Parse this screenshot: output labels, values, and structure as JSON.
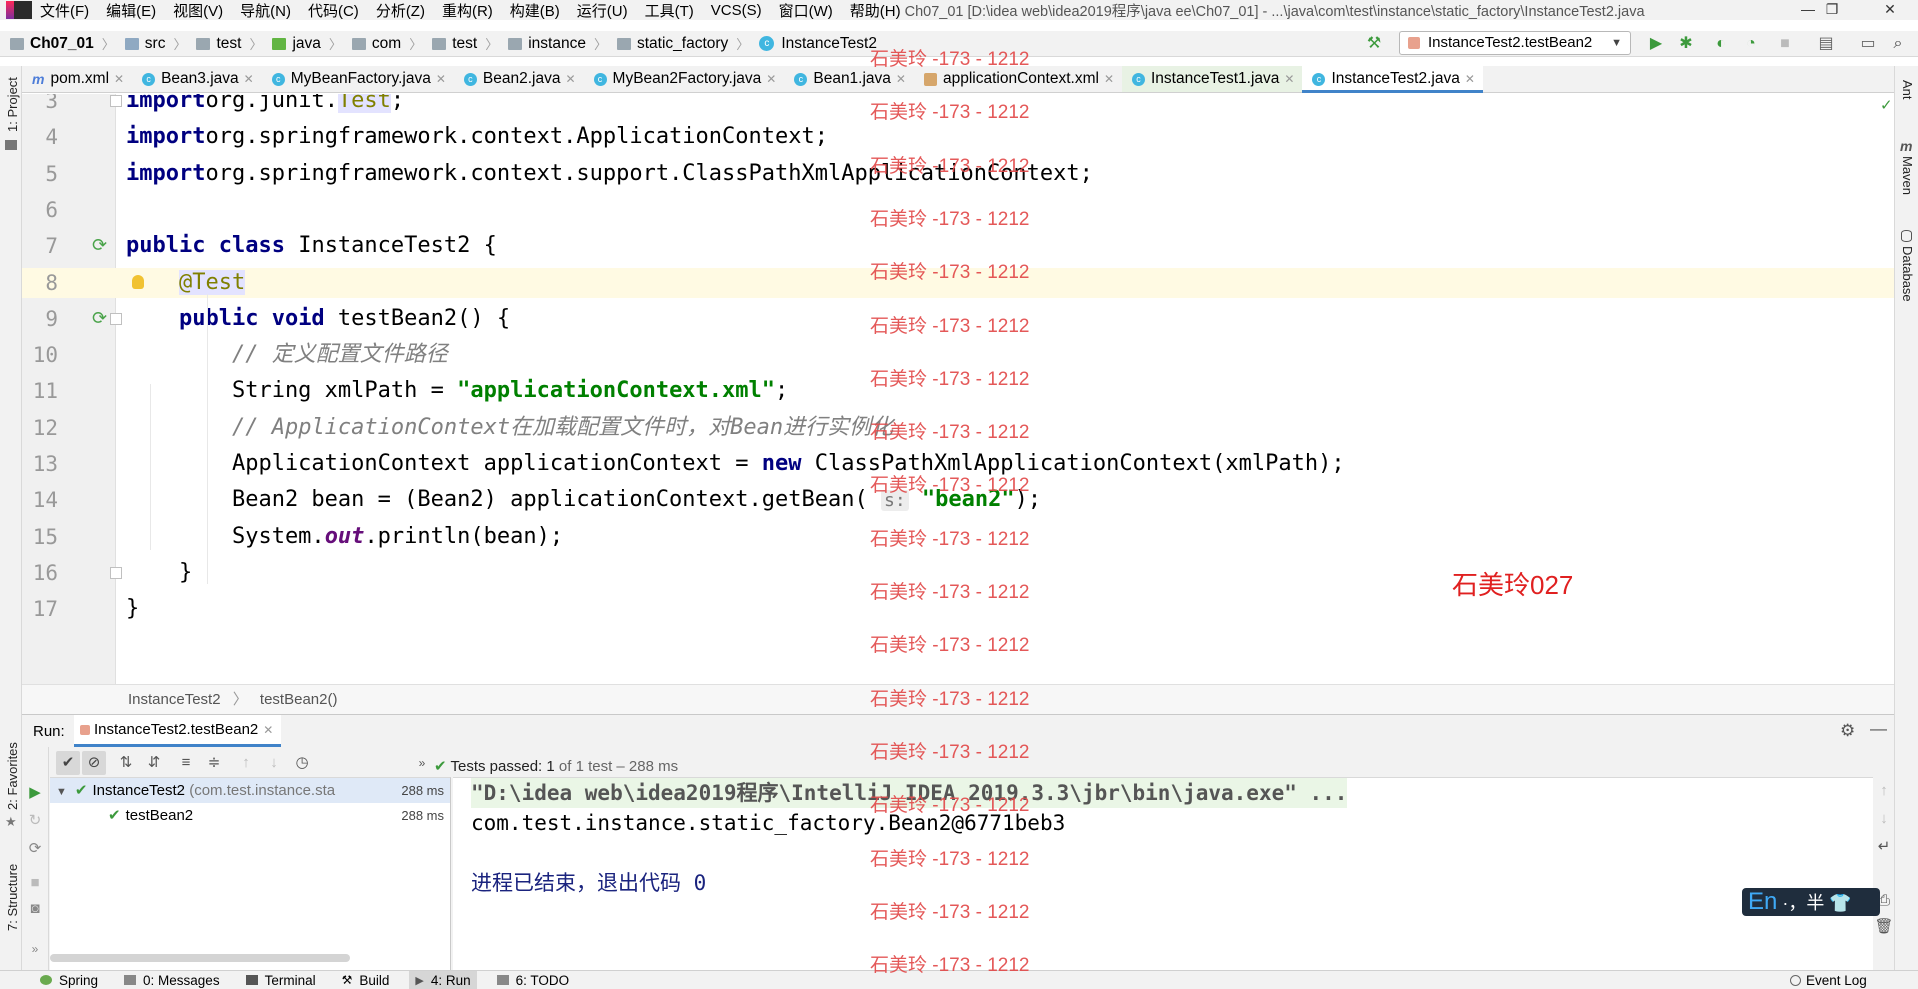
{
  "menubar": {
    "items": [
      "文件(F)",
      "编辑(E)",
      "视图(V)",
      "导航(N)",
      "代码(C)",
      "分析(Z)",
      "重构(R)",
      "构建(B)",
      "运行(U)",
      "工具(T)",
      "VCS(S)",
      "窗口(W)",
      "帮助(H)"
    ],
    "title": "Ch07_01 [D:\\idea web\\idea2019程序\\java ee\\Ch07_01] - ...\\java\\com\\test\\instance\\static_factory\\InstanceTest2.java"
  },
  "breadcrumb": [
    "Ch07_01",
    "src",
    "test",
    "java",
    "com",
    "test",
    "instance",
    "static_factory",
    "InstanceTest2"
  ],
  "run_config": "InstanceTest2.testBean2",
  "tabs": [
    "pom.xml",
    "Bean3.java",
    "MyBeanFactory.java",
    "Bean2.java",
    "MyBean2Factory.java",
    "Bean1.java",
    "applicationContext.xml",
    "InstanceTest1.java",
    "InstanceTest2.java"
  ],
  "left_tools": [
    "1: Project",
    "2: Favorites",
    "7: Structure"
  ],
  "right_tools": [
    "Ant",
    "Maven",
    "Database"
  ],
  "editor": {
    "lines": [
      {
        "n": "3",
        "tokens": [
          [
            "kw",
            "import"
          ],
          [
            "",
            "org.junit."
          ],
          [
            "ann",
            "Test"
          ],
          [
            "",
            ";"
          ]
        ]
      },
      {
        "n": "4",
        "tokens": [
          [
            "kw",
            "import"
          ],
          [
            "",
            "org.springframework.context.ApplicationContext;"
          ]
        ]
      },
      {
        "n": "5",
        "tokens": [
          [
            "kw",
            "import"
          ],
          [
            "",
            "org.springframework.context.support.ClassPathXmlApplicationContext;"
          ]
        ]
      },
      {
        "n": "6",
        "tokens": []
      },
      {
        "n": "7",
        "tokens": [
          [
            "kw",
            "public class"
          ],
          [
            "",
            " InstanceTest2 {"
          ]
        ]
      },
      {
        "n": "8",
        "tokens": [
          [
            "",
            "    "
          ],
          [
            "ann",
            "@Test"
          ]
        ]
      },
      {
        "n": "9",
        "tokens": [
          [
            "",
            "    "
          ],
          [
            "kw",
            "public void"
          ],
          [
            "",
            " testBean2() {"
          ]
        ]
      },
      {
        "n": "10",
        "tokens": [
          [
            "",
            "        "
          ],
          [
            "cm",
            "// 定义配置文件路径"
          ]
        ]
      },
      {
        "n": "11",
        "tokens": [
          [
            "",
            "        String xmlPath = "
          ],
          [
            "str",
            "\"applicationContext.xml\""
          ],
          [
            "",
            ";"
          ]
        ]
      },
      {
        "n": "12",
        "tokens": [
          [
            "",
            "        "
          ],
          [
            "cm",
            "// ApplicationContext在加载配置文件时，对Bean进行实例化"
          ]
        ]
      },
      {
        "n": "13",
        "tokens": [
          [
            "",
            "        ApplicationContext applicationContext = "
          ],
          [
            "kw",
            "new"
          ],
          [
            "",
            " ClassPathXmlApplicationContext(xmlPath);"
          ]
        ]
      },
      {
        "n": "14",
        "tokens": [
          [
            "",
            "        Bean2 bean = (Bean2) applicationContext.getBean( "
          ],
          [
            "hint",
            "s:"
          ],
          [
            "",
            " "
          ],
          [
            "str",
            "\"bean2\""
          ],
          [
            "",
            ");"
          ]
        ]
      },
      {
        "n": "15",
        "tokens": [
          [
            "",
            "        System."
          ],
          [
            "field",
            "out"
          ],
          [
            "",
            ".println(bean);"
          ]
        ]
      },
      {
        "n": "16",
        "tokens": [
          [
            "",
            "    }"
          ]
        ]
      },
      {
        "n": "17",
        "tokens": [
          [
            "",
            "}"
          ]
        ]
      }
    ]
  },
  "editor_breadcrumb": [
    "InstanceTest2",
    "testBean2()"
  ],
  "run_panel": {
    "label": "Run:",
    "tab": "InstanceTest2.testBean2",
    "status_prefix": "Tests passed:",
    "status_count": "1",
    "status_rest": "of 1 test – 288 ms",
    "tree": [
      {
        "name": "InstanceTest2",
        "pkg": "(com.test.instance.sta",
        "time": "288 ms"
      },
      {
        "name": "testBean2",
        "pkg": "",
        "time": "288 ms"
      }
    ],
    "console": [
      "\"D:\\idea web\\idea2019程序\\IntelliJ IDEA 2019.3.3\\jbr\\bin\\java.exe\" ...",
      "com.test.instance.static_factory.Bean2@6771beb3",
      "",
      "进程已结束，退出代码 0"
    ]
  },
  "bottom_tools": [
    "Spring",
    "0: Messages",
    "Terminal",
    "Build",
    "4: Run",
    "6: TODO",
    "Event Log"
  ],
  "watermark": "石美玲 -173 - 1212",
  "stamp": "石美玲027",
  "ime": {
    "lang": "En",
    "rest": "·，半"
  }
}
